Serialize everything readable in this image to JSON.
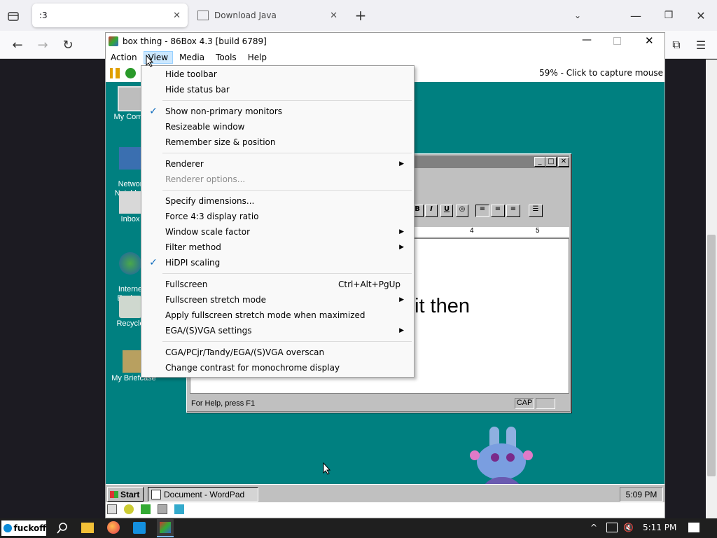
{
  "browser": {
    "tabs": [
      {
        "label": ":3",
        "active": true
      },
      {
        "label": "Download Java",
        "active": false
      }
    ],
    "new_tab": "+"
  },
  "vm_window": {
    "title": "box thing - 86Box 4.3 [build 6789]",
    "menus": [
      "Action",
      "View",
      "Media",
      "Tools",
      "Help"
    ],
    "open_menu": "View",
    "capture_text": "59% - Click to capture mouse"
  },
  "view_menu": {
    "items": [
      {
        "label": "Hide toolbar"
      },
      {
        "label": "Hide status bar"
      },
      {
        "label": "Show non-primary monitors",
        "checked": true
      },
      {
        "label": "Resizeable window"
      },
      {
        "label": "Remember size & position"
      },
      {
        "label": "Renderer",
        "submenu": true
      },
      {
        "label": "Renderer options...",
        "disabled": true
      },
      {
        "label": "Specify dimensions..."
      },
      {
        "label": "Force 4:3 display ratio"
      },
      {
        "label": "Window scale factor",
        "submenu": true
      },
      {
        "label": "Filter method",
        "submenu": true
      },
      {
        "label": "HiDPI scaling",
        "checked": true
      },
      {
        "label": "Fullscreen",
        "shortcut": "Ctrl+Alt+PgUp"
      },
      {
        "label": "Fullscreen stretch mode",
        "submenu": true
      },
      {
        "label": "Apply fullscreen stretch mode when maximized"
      },
      {
        "label": "EGA/(S)VGA settings",
        "submenu": true
      },
      {
        "label": "CGA/PCjr/Tandy/EGA/(S)VGA overscan"
      },
      {
        "label": "Change contrast for monochrome display"
      }
    ]
  },
  "win98": {
    "desktop_icons": [
      "My Comp",
      "Networ\nNeighbor",
      "Inbox",
      "Interne\nExplore",
      "Recycle",
      "My Briefcase"
    ],
    "wordpad": {
      "doc_text": "it then",
      "status": "For Help, press F1",
      "cap": "CAP",
      "ruler": [
        "4",
        "5"
      ]
    },
    "taskbar": {
      "start": "Start",
      "task": "Document - WordPad",
      "clock": "5:09 PM"
    }
  },
  "host_taskbar": {
    "start_label": "fuckoff",
    "clock": "5:11 PM"
  }
}
